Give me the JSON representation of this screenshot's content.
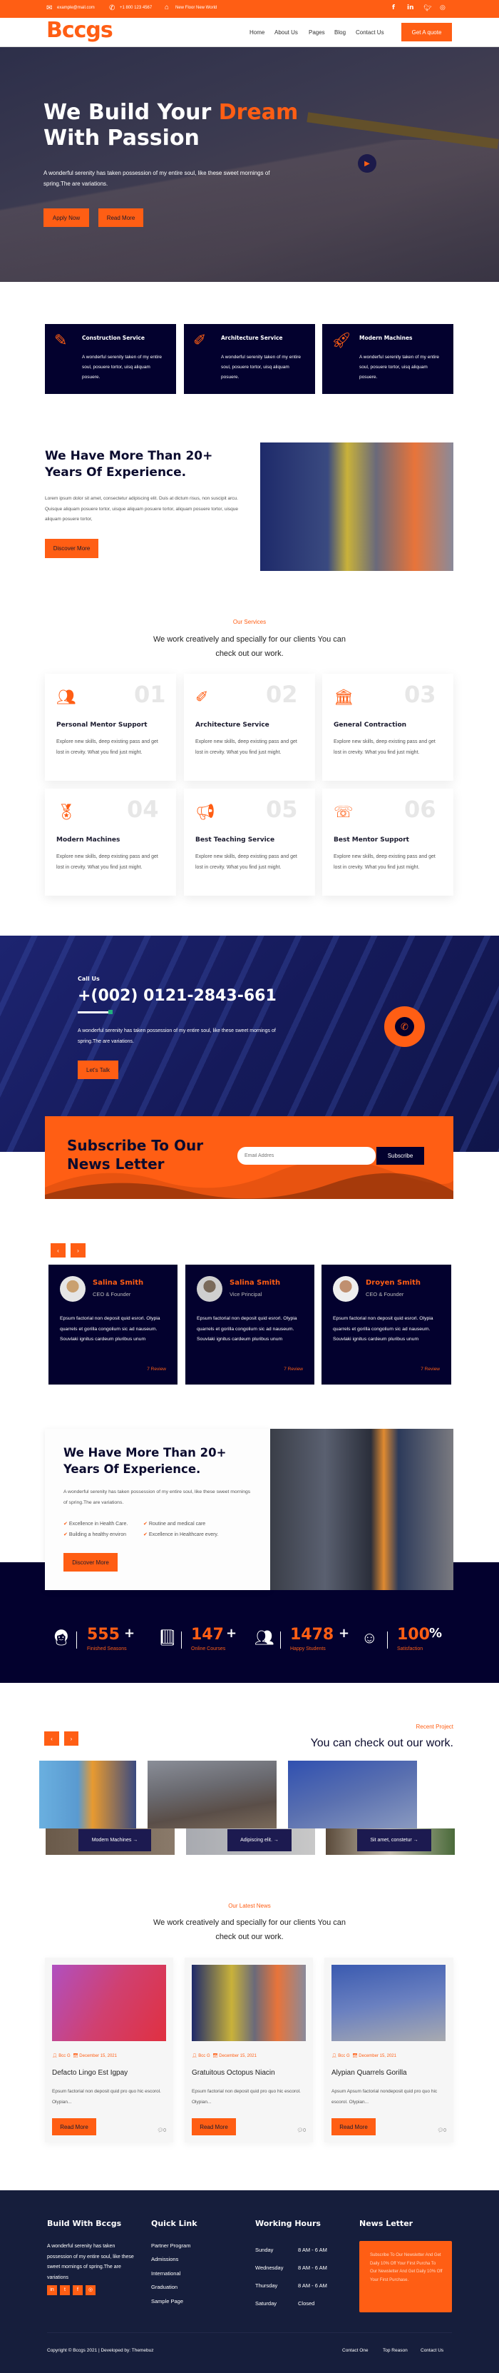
{
  "colors": {
    "accent": "#ff5e14",
    "navy": "#03012e",
    "footer": "#161e3c"
  },
  "topbar": {
    "email": "example@mail.com",
    "phone": "+1 800 123 4567",
    "address": "New Floor New World",
    "social": [
      "facebook-icon",
      "linkedin-icon",
      "twitter-icon",
      "instagram-icon"
    ]
  },
  "header": {
    "logo": "Bccgs",
    "nav": [
      "Home",
      "About Us",
      "Pages",
      "Blog",
      "Contact Us"
    ],
    "cta": "Get A quote"
  },
  "hero": {
    "title_a": "We Build Your ",
    "title_accent": "Dream",
    "title_b": "With Passion",
    "text": "A wonderful serenity has taken possession of my entire soul, like these sweet mornings of spring.The are variations.",
    "btn1": "Apply Now",
    "btn2": "Read More"
  },
  "features": [
    {
      "icon": "document-pen-icon",
      "title": "Construction Service",
      "text": "A wonderful serenity taken of my entire soul, posuere tortor, uisq aliquam posuere."
    },
    {
      "icon": "pencil-ruler-icon",
      "title": "Architecture Service",
      "text": "A wonderful serenity taken of my entire soul, posuere tortor, uisq aliquam posuere."
    },
    {
      "icon": "rocket-icon",
      "title": "Modern Machines",
      "text": "A wonderful serenity taken of my entire soul, posuere tortor, uisq aliquam posuere."
    }
  ],
  "about": {
    "title": "We Have More Than 20+ Years Of Experience.",
    "text": "Lorem ipsum dolor sit amet, consectetur adipiscing elit. Duis at dictum risus, non suscipit arcu. Quisque aliquam posuere tortor, uisque aliquam posuere tortor, aliquam posuere tortor, uisque aliquam posuere tortor,",
    "button": "Discover More"
  },
  "services": {
    "label": "Our Services",
    "heading": "We work creatively and specially for our clients You can check out our work.",
    "items": [
      {
        "num": "01",
        "icon": "team-icon",
        "title": "Personal Mentor Support",
        "text": "Explore new skills, deep existing pass and get lost in crevity. What you find just might."
      },
      {
        "num": "02",
        "icon": "pencil-ruler-icon",
        "title": "Architecture Service",
        "text": "Explore new skills, deep existing pass and get lost in crevity. What you find just might."
      },
      {
        "num": "03",
        "icon": "building-icon",
        "title": "General Contraction",
        "text": "Explore new skills, deep existing pass and get lost in crevity. What you find just might."
      },
      {
        "num": "04",
        "icon": "award-icon",
        "title": "Modern Machines",
        "text": "Explore new skills, deep existing pass and get lost in crevity. What you find just might."
      },
      {
        "num": "05",
        "icon": "megaphone-icon",
        "title": "Best Teaching Service",
        "text": "Explore new skills, deep existing pass and get lost in crevity. What you find just might."
      },
      {
        "num": "06",
        "icon": "support-icon",
        "title": "Best Mentor Support",
        "text": "Explore new skills, deep existing pass and get lost in crevity. What you find just might."
      }
    ]
  },
  "call": {
    "label": "Call Us",
    "phone": "+(002) 0121-2843-661",
    "text": "A wonderful serenity has taken possession of my entire soul, like these sweet mornings of spring.The are variations.",
    "button": "Let's Talk"
  },
  "subscribe": {
    "title": "Subscribe To Our News Letter",
    "placeholder": "Email Addres",
    "button": "Subscribe"
  },
  "testimonials": [
    {
      "name": "Salina Smith",
      "role": "CEO & Founder",
      "text": "Epsum factorial non deposit quid esrorl. Olypia quarrels et gorilla congolium sic ad nauseum. Souvlaki ignitus cardeum pluribus unum",
      "review": "7 Review"
    },
    {
      "name": "Salina Smith",
      "role": "Vice Principal",
      "text": "Epsum factorial non deposit quid esrorl. Olypia quarrels et gorilla congolium sic ad nauseum. Souvlaki ignitus cardeum pluribus unum",
      "review": "7 Review"
    },
    {
      "name": "Droyen Smith",
      "role": "CEO & Founder",
      "text": "Epsum factorial non deposit quid esrorl. Olypia quarrels et gorilla congolium sic ad nauseum. Souvlaki ignitus cardeum pluribus unum",
      "review": "7 Review"
    }
  ],
  "about2": {
    "title": "We Have More Than 20+ Years Of Experience.",
    "text": "A wonderful serenity has taken possession of my entire soul, like these sweet mornings of spring.The are variations.",
    "checks": [
      "Excellence in Health Care.",
      "Routine and medical care",
      "Building a healthy environ",
      "Excellence in Healthcare every."
    ],
    "button": "Discover More"
  },
  "stats": [
    {
      "icon": "consultant-icon",
      "value": "555",
      "suffix": "+",
      "label": "Finished Seasons"
    },
    {
      "icon": "book-icon",
      "value": "147",
      "suffix": "+",
      "label": "Online Courses"
    },
    {
      "icon": "students-icon",
      "value": "1478",
      "suffix": "+",
      "label": "Happy Students"
    },
    {
      "icon": "smile-icon",
      "value": "100",
      "suffix": "%",
      "label": "Satisfaction"
    }
  ],
  "projects": {
    "label": "Recent Project",
    "heading": "You can check out our work.",
    "items": [
      "Modern Machines",
      "Adipiscing elit.",
      "Sit amet, constetur"
    ]
  },
  "news": {
    "label": "Our Latest News",
    "heading": "We work creatively and specially for our clients You can check out our work.",
    "items": [
      {
        "author": "Bcc G",
        "date": "December 15, 2021",
        "title": "Defacto Lingo Est Igpay",
        "text": "Epsum factorial non deposit quid pro quo hic escorol. Olypian...",
        "button": "Read More",
        "comments": "0"
      },
      {
        "author": "Bcc G",
        "date": "December 15, 2021",
        "title": "Gratuitous Octopus Niacin",
        "text": "Epsum factorial non deposit quid pro quo hic escorol. Olypian...",
        "button": "Read More",
        "comments": "0"
      },
      {
        "author": "Bcc G",
        "date": "December 15, 2021",
        "title": "Alypian Quarrels Gorilla",
        "text": "Apsum Apsum factorial nondeposit quid pro quo hic escorol. Olypian...",
        "button": "Read More",
        "comments": "0"
      }
    ]
  },
  "footer": {
    "about_title": "Build With Bccgs",
    "about_text": "A wonderful serenity has taken possession of my entire soul, like these sweet mornings of spring.The are variations",
    "links_title": "Quick Link",
    "links": [
      "Partner Program",
      "Admissions",
      "International",
      "Graduation",
      "Sample Page"
    ],
    "hours_title": "Working Hours",
    "hours": [
      {
        "day": "Sunday",
        "time": "8 AM - 6 AM"
      },
      {
        "day": "Wednesday",
        "time": "8 AM - 6 AM"
      },
      {
        "day": "Thursday",
        "time": "8 AM - 6 AM"
      },
      {
        "day": "Saturday",
        "time": "Closed"
      }
    ],
    "news_title": "News Letter",
    "news_text": "Subscribe To Our Newsletter And Get Daily 10% Off Your First Purcha To Our Newsletter And Get Daily 10% Off Your First Purchase.",
    "copyright": "Copyright © Bccgs 2021 | Developed by: Themebuz",
    "bottom_links": [
      "Contact One",
      "Top Reason",
      "Contact Us"
    ]
  }
}
